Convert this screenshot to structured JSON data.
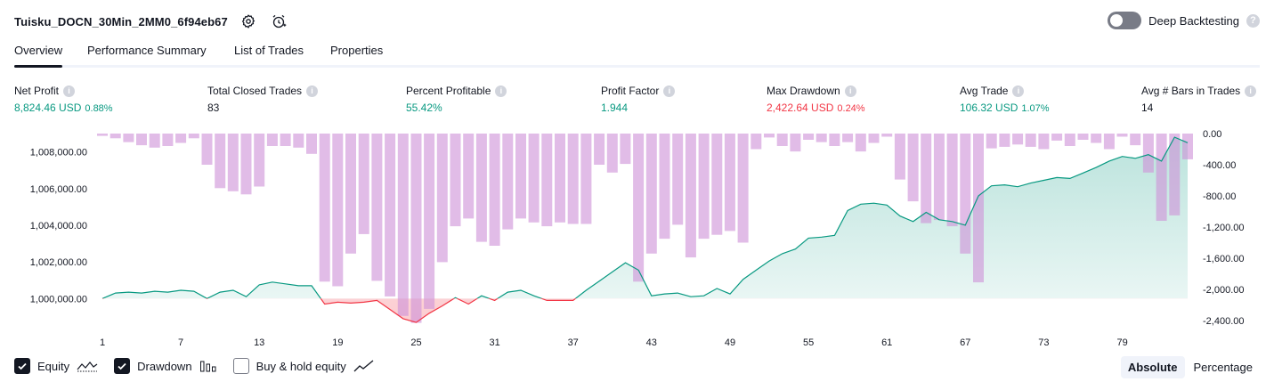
{
  "header": {
    "strategy_name": "Tuisku_DOCN_30Min_2MM0_6f94eb67",
    "deep_backtesting_label": "Deep Backtesting",
    "deep_backtesting_on": false
  },
  "tabs": [
    {
      "label": "Overview",
      "active": true
    },
    {
      "label": "Performance Summary",
      "active": false
    },
    {
      "label": "List of Trades",
      "active": false
    },
    {
      "label": "Properties",
      "active": false
    }
  ],
  "metrics": [
    {
      "label": "Net Profit",
      "value": "8,824.46 USD",
      "pct": "0.88%",
      "color": "green"
    },
    {
      "label": "Total Closed Trades",
      "value": "83",
      "pct": "",
      "color": "dark"
    },
    {
      "label": "Percent Profitable",
      "value": "55.42%",
      "pct": "",
      "color": "green"
    },
    {
      "label": "Profit Factor",
      "value": "1.944",
      "pct": "",
      "color": "green"
    },
    {
      "label": "Max Drawdown",
      "value": "2,422.64 USD",
      "pct": "0.24%",
      "color": "red"
    },
    {
      "label": "Avg Trade",
      "value": "106.32 USD",
      "pct": "1.07%",
      "color": "green"
    },
    {
      "label": "Avg # Bars in Trades",
      "value": "14",
      "pct": "",
      "color": "dark"
    }
  ],
  "chart_data": {
    "type": "area",
    "left_axis": {
      "ticks": [
        "1,008,000.00",
        "1,006,000.00",
        "1,004,000.00",
        "1,002,000.00",
        "1,000,000.00"
      ],
      "values": [
        1008000,
        1006000,
        1004000,
        1002000,
        1000000
      ],
      "range": [
        998800,
        1009000
      ]
    },
    "right_axis": {
      "ticks": [
        "0.00",
        "-400.00",
        "-800.00",
        "-1,200.00",
        "-1,600.00",
        "-2,000.00",
        "-2,400.00"
      ],
      "values": [
        0,
        -400,
        -800,
        -1200,
        -1600,
        -2000,
        -2400
      ],
      "range": [
        -2400,
        0
      ]
    },
    "x_ticks": [
      "1",
      "7",
      "13",
      "19",
      "25",
      "31",
      "37",
      "43",
      "49",
      "55",
      "61",
      "67",
      "73",
      "79"
    ],
    "x_range": [
      1,
      84
    ],
    "equity": [
      1000000,
      1000300,
      1000350,
      1000300,
      1000400,
      1000350,
      1000450,
      1000400,
      1000000,
      1000350,
      1000450,
      1000100,
      1000750,
      1000900,
      1000800,
      1000700,
      1000700,
      999700,
      999800,
      999750,
      999800,
      999900,
      999400,
      998900,
      998700,
      999200,
      999600,
      1000050,
      999700,
      1000150,
      999900,
      1000350,
      1000450,
      1000150,
      999900,
      999900,
      999900,
      1000450,
      1000950,
      1001450,
      1001950,
      1001550,
      1000150,
      1000250,
      1000300,
      1000100,
      1000150,
      1000550,
      1000250,
      1001050,
      1001550,
      1002050,
      1002450,
      1002700,
      1003300,
      1003350,
      1003450,
      1004800,
      1005150,
      1005200,
      1005100,
      1004500,
      1004200,
      1004700,
      1004300,
      1004200,
      1004000,
      1005600,
      1006150,
      1006200,
      1006100,
      1006300,
      1006450,
      1006600,
      1006550,
      1006850,
      1007150,
      1007500,
      1007750,
      1007650,
      1007850,
      1007500,
      1008800,
      1008500
    ],
    "drawdown": [
      -30,
      -60,
      -110,
      -150,
      -180,
      -160,
      -120,
      -60,
      -400,
      -700,
      -740,
      -780,
      -680,
      -160,
      -160,
      -180,
      -260,
      -1900,
      -1960,
      -1540,
      -1290,
      -1890,
      -2090,
      -2340,
      -2430,
      -2250,
      -1650,
      -1190,
      -1090,
      -1390,
      -1440,
      -1230,
      -1090,
      -1140,
      -1190,
      -1140,
      -1160,
      -1160,
      -400,
      -500,
      -390,
      -1900,
      -1540,
      -1350,
      -1170,
      -1590,
      -1350,
      -1300,
      -1250,
      -1400,
      -200,
      -50,
      -160,
      -230,
      -80,
      -110,
      -160,
      -110,
      -230,
      -120,
      -40,
      -590,
      -870,
      -1150,
      -1110,
      -1190,
      -1540,
      -1910,
      -190,
      -170,
      -140,
      -170,
      -200,
      -90,
      -160,
      -80,
      -120,
      -200,
      -40,
      -150,
      -500,
      -1120,
      -1050,
      -330
    ],
    "equity_color": "#089981",
    "equity_negative_color": "#f23645",
    "drawdown_color": "#ce93d8"
  },
  "legend": [
    {
      "label": "Equity",
      "checked": true,
      "icon": "equity-line-icon"
    },
    {
      "label": "Drawdown",
      "checked": true,
      "icon": "drawdown-bars-icon"
    },
    {
      "label": "Buy & hold equity",
      "checked": false,
      "icon": "buy-hold-line-icon"
    }
  ],
  "mode_toggle": {
    "absolute_label": "Absolute",
    "percentage_label": "Percentage",
    "selected": "Absolute"
  }
}
